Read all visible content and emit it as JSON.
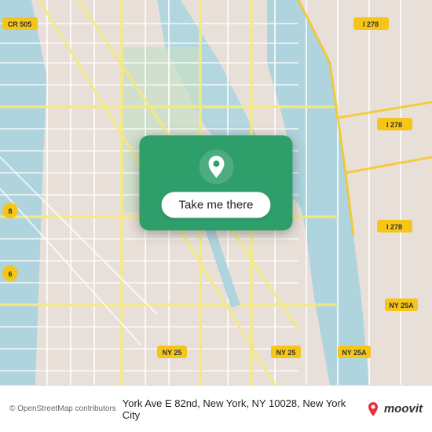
{
  "map": {
    "bg_color": "#e8e0d8",
    "alt": "Map of York Ave E 82nd, New York, NY"
  },
  "overlay": {
    "button_label": "Take me there",
    "pin_color": "#ffffff",
    "card_bg": "#2e9e6b"
  },
  "bottom_bar": {
    "copyright": "© OpenStreetMap contributors",
    "address": "York Ave E 82nd, New York, NY 10028, New York City",
    "moovit_label": "moovit"
  },
  "icons": {
    "location_pin": "location-pin-icon",
    "moovit_pin": "moovit-pin-icon"
  }
}
